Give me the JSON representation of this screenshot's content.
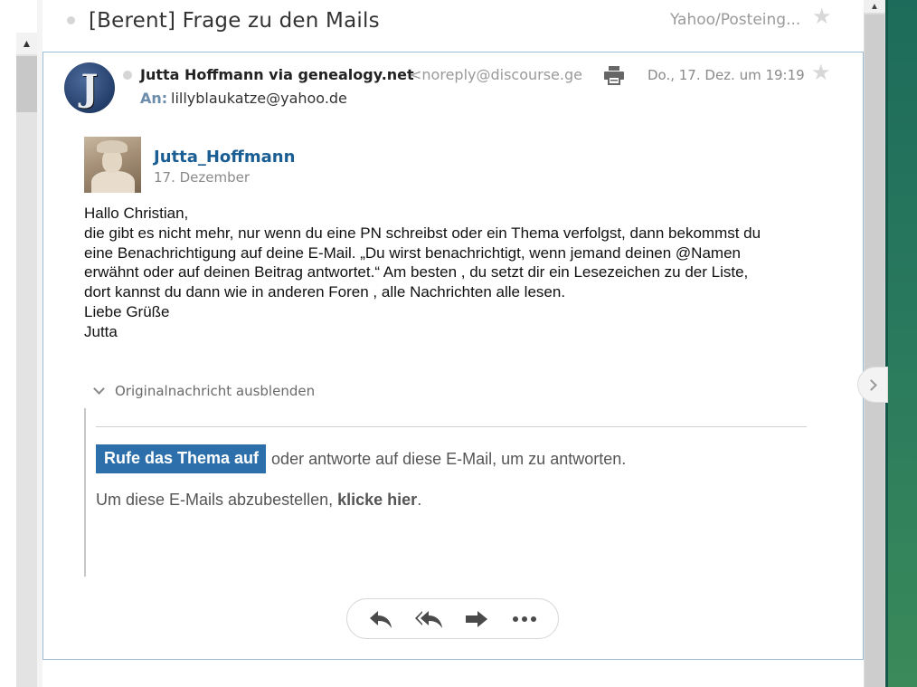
{
  "subject": {
    "title": "[Berent] Frage zu den Mails",
    "folder": "Yahoo/Posteing..."
  },
  "message": {
    "avatar_letter": "J",
    "sender_name": "Jutta Hoffmann via genealogy.net",
    "sender_email": "<noreply@discourse.ge",
    "date": "Do., 17. Dez. um 19:19",
    "to_label": "An:",
    "to_value": "lillyblaukatze@yahoo.de"
  },
  "post": {
    "author": "Jutta_Hoffmann",
    "date": "17. Dezember",
    "lines": [
      "Hallo Christian,",
      "die gibt es nicht mehr, nur wenn du eine PN schreibst oder ein Thema verfolgst, dann bekommst du",
      "eine Benachrichtigung auf deine E-Mail. „Du wirst benachrichtigt, wenn jemand deinen @Namen",
      "erwähnt oder auf deinen Beitrag antwortet.“ Am besten , du setzt dir ein Lesezeichen zu der Liste,",
      "dort kannst du dann wie in anderen Foren , alle Nachrichten alle lesen.",
      "Liebe Grüße",
      "Jutta"
    ]
  },
  "original": {
    "toggle_label": "Originalnachricht ausblenden",
    "cta_button": "Rufe das Thema auf",
    "cta_rest": "oder antworte auf diese E-Mail, um zu antworten.",
    "unsub_text": "Um diese E-Mails abzubestellen, ",
    "unsub_link": "klicke hier",
    "unsub_end": "."
  },
  "icons": {
    "print": "printer-icon",
    "star": "star-icon",
    "reply": "reply-icon",
    "reply_all": "reply-all-icon",
    "forward": "forward-icon",
    "more": "more-icon"
  },
  "colors": {
    "accent": "#2c6faa",
    "author_link": "#1a5e94",
    "card_border": "#9bbbd6"
  }
}
